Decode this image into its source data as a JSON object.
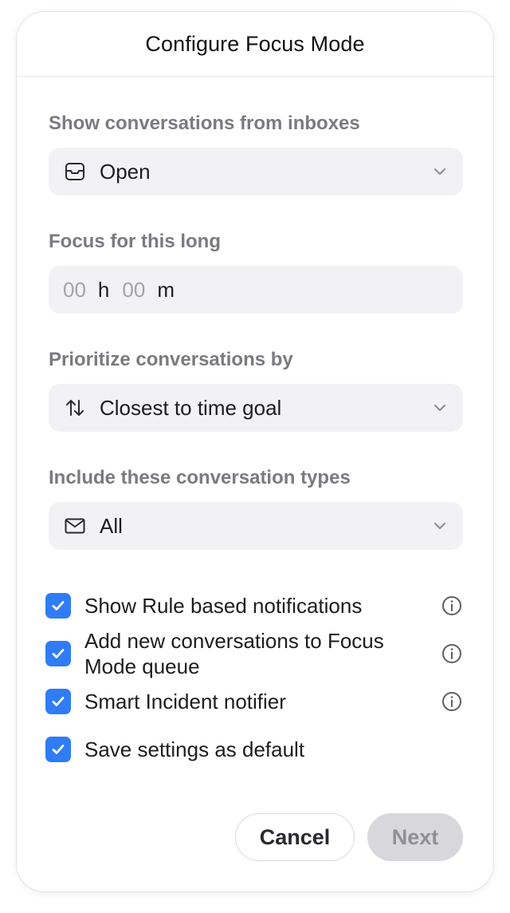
{
  "dialog": {
    "title": "Configure Focus Mode"
  },
  "inboxes": {
    "label": "Show conversations from inboxes",
    "value": "Open",
    "icon": "inbox-tray-icon"
  },
  "duration": {
    "label": "Focus for this long",
    "hours_placeholder": "00",
    "hours_unit": "h",
    "minutes_placeholder": "00",
    "minutes_unit": "m"
  },
  "priority": {
    "label": "Prioritize conversations by",
    "value": "Closest to time goal",
    "icon": "sort-arrows-icon"
  },
  "types": {
    "label": "Include these conversation types",
    "value": "All",
    "icon": "envelope-icon"
  },
  "options": [
    {
      "label": "Show Rule based notifications",
      "checked": true,
      "has_info": true
    },
    {
      "label": "Add new conversations to Focus Mode queue",
      "checked": true,
      "has_info": true
    },
    {
      "label": "Smart Incident notifier",
      "checked": true,
      "has_info": true
    },
    {
      "label": "Save settings as default",
      "checked": true,
      "has_info": false
    }
  ],
  "actions": {
    "cancel_label": "Cancel",
    "next_label": "Next"
  },
  "colors": {
    "checkbox": "#2f7cf6",
    "field_bg": "#f2f2f4",
    "label_gray": "#7a7a80",
    "next_disabled_bg": "#d8d8dc"
  }
}
